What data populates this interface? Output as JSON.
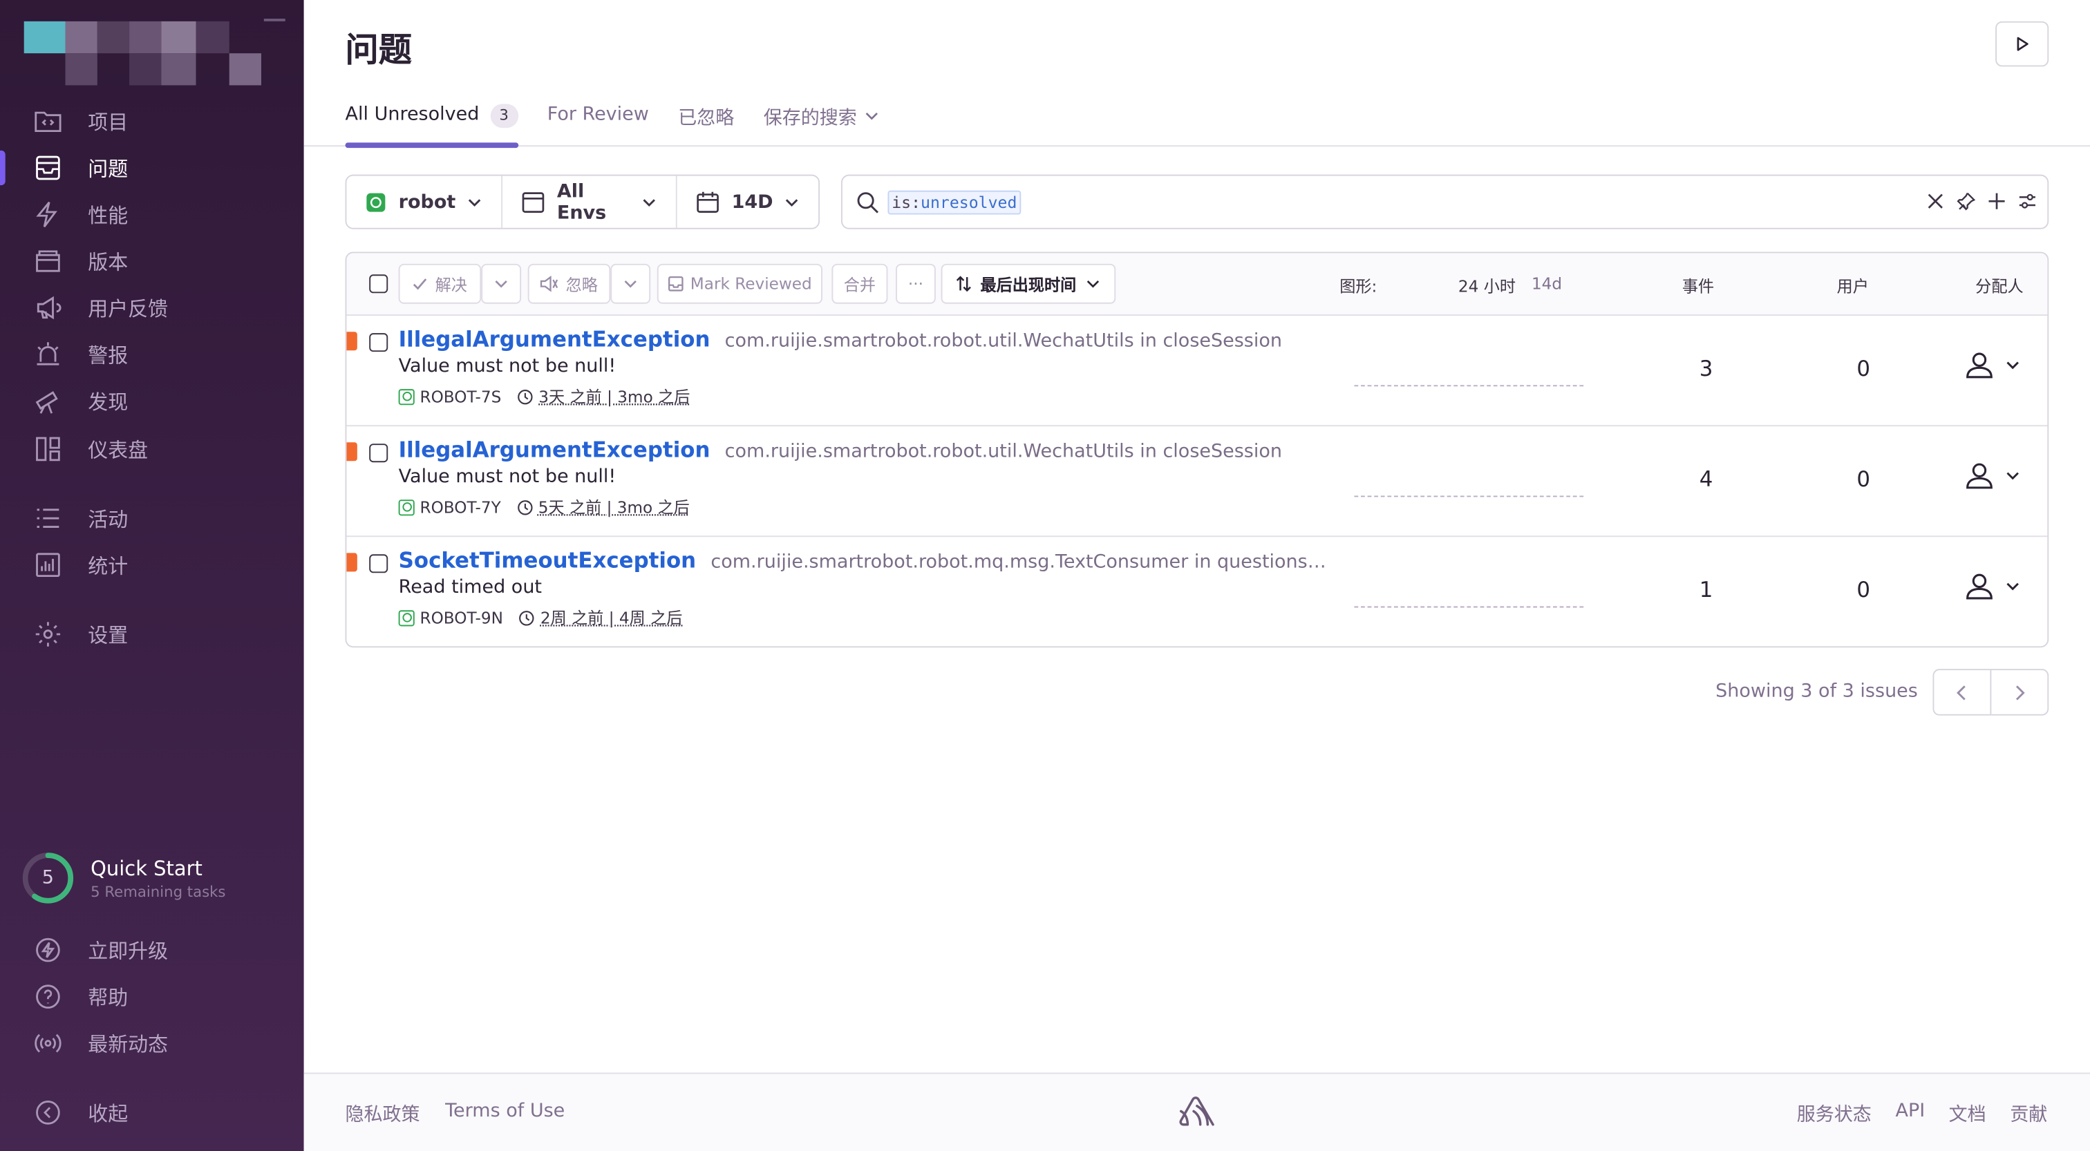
{
  "sidebar": {
    "items": [
      {
        "label": "项目",
        "icon": "folder-code-icon"
      },
      {
        "label": "问题",
        "icon": "inbox-stack-icon",
        "active": true
      },
      {
        "label": "性能",
        "icon": "lightning-icon"
      },
      {
        "label": "版本",
        "icon": "package-icon"
      },
      {
        "label": "用户反馈",
        "icon": "megaphone-icon"
      },
      {
        "label": "警报",
        "icon": "siren-icon"
      },
      {
        "label": "发现",
        "icon": "telescope-icon"
      },
      {
        "label": "仪表盘",
        "icon": "dashboard-icon"
      },
      {
        "label": "活动",
        "icon": "list-icon"
      },
      {
        "label": "统计",
        "icon": "bar-chart-icon"
      },
      {
        "label": "设置",
        "icon": "gear-icon"
      }
    ],
    "quick_start": {
      "count": "5",
      "title": "Quick Start",
      "subtitle": "5 Remaining tasks",
      "progress": 0.6
    },
    "bottom": [
      {
        "label": "立即升级",
        "icon": "upgrade-icon"
      },
      {
        "label": "帮助",
        "icon": "question-icon"
      },
      {
        "label": "最新动态",
        "icon": "broadcast-icon"
      },
      {
        "label": "收起",
        "icon": "collapse-icon"
      }
    ]
  },
  "header": {
    "title": "问题",
    "tabs": [
      {
        "label": "All Unresolved",
        "count": "3",
        "active": true
      },
      {
        "label": "For Review"
      },
      {
        "label": "已忽略"
      },
      {
        "label": "保存的搜索"
      }
    ]
  },
  "filters": {
    "project": "robot",
    "env": "All Envs",
    "period": "14D",
    "search_key": "is:",
    "search_value": "unresolved"
  },
  "table": {
    "actions": {
      "resolve": "解决",
      "ignore": "忽略",
      "mark_reviewed": "Mark Reviewed",
      "merge": "合并",
      "more": "···",
      "sort": "最后出现时间"
    },
    "columns": {
      "graph": "图形:",
      "graph_24h": "24 小时",
      "graph_14d": "14d",
      "events": "事件",
      "users": "用户",
      "assignee": "分配人"
    },
    "rows": [
      {
        "type": "IllegalArgumentException",
        "culprit": "com.ruijie.smartrobot.robot.util.WechatUtils in closeSession",
        "message": "Value must not be null!",
        "short_id": "ROBOT-7S",
        "times": "3天 之前 | 3mo 之后",
        "events": "3",
        "users": "0"
      },
      {
        "type": "IllegalArgumentException",
        "culprit": "com.ruijie.smartrobot.robot.util.WechatUtils in closeSession",
        "message": "Value must not be null!",
        "short_id": "ROBOT-7Y",
        "times": "5天 之前 | 3mo 之后",
        "events": "4",
        "users": "0"
      },
      {
        "type": "SocketTimeoutException",
        "culprit": "com.ruijie.smartrobot.robot.mq.msg.TextConsumer in questionsBai…",
        "message": "Read timed out",
        "short_id": "ROBOT-9N",
        "times": "2周 之前 | 4周 之后",
        "events": "1",
        "users": "0"
      }
    ]
  },
  "pagination": {
    "info": "Showing 3 of 3 issues"
  },
  "footer": {
    "privacy": "隐私政策",
    "terms": "Terms of Use",
    "status": "服务状态",
    "api": "API",
    "docs": "文档",
    "contribute": "贡献"
  },
  "colors": {
    "accent": "#6c5fc7",
    "link": "#2562d4",
    "level_error": "#f2692e",
    "sidebar_top": "#2f1937",
    "sidebar_bottom": "#452650"
  }
}
